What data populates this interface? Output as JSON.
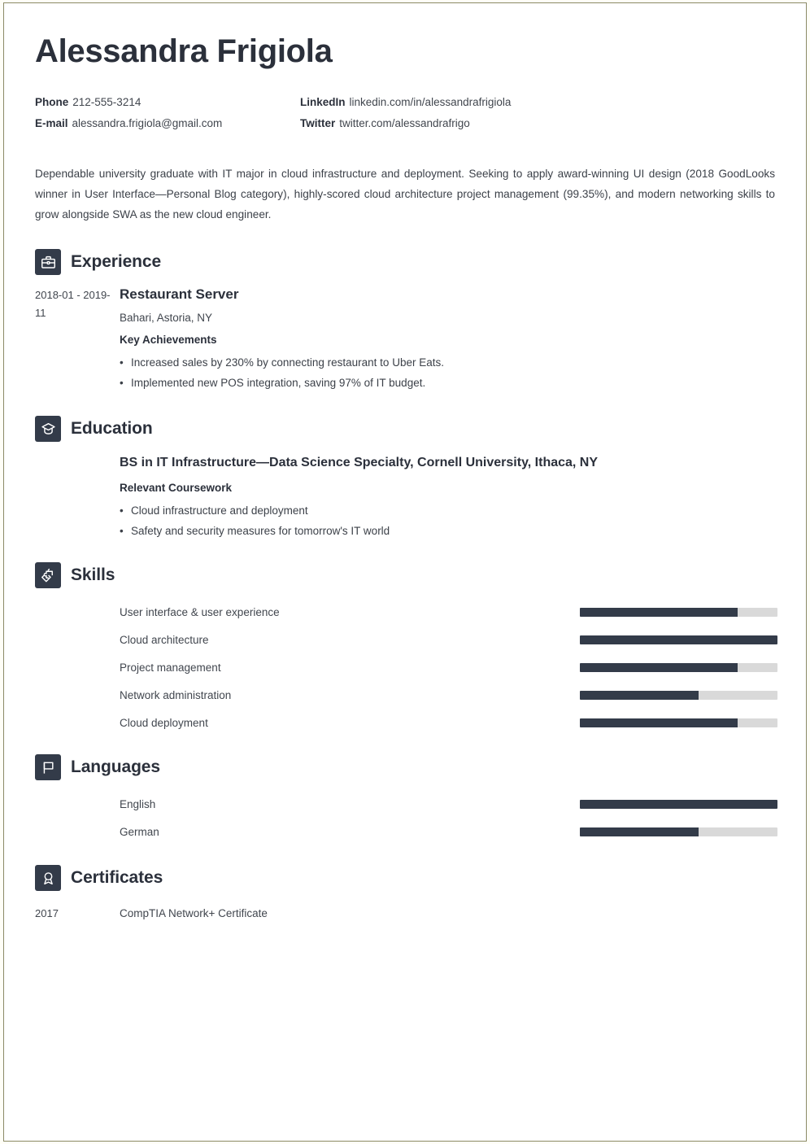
{
  "resume": {
    "name": "Alessandra Frigiola",
    "contact": [
      {
        "label": "Phone",
        "value": "212-555-3214",
        "icon": "phone-icon"
      },
      {
        "label": "LinkedIn",
        "value": "linkedin.com/in/alessandrafrigiola",
        "icon": "linkedin-icon"
      },
      {
        "label": "E-mail",
        "value": "alessandra.frigiola@gmail.com",
        "icon": "email-icon"
      },
      {
        "label": "Twitter",
        "value": "twitter.com/alessandrafrigo",
        "icon": "twitter-icon"
      }
    ],
    "summary": "Dependable university graduate with IT major in cloud infrastructure and deployment. Seeking to apply award-winning UI design (2018 GoodLooks winner in User Interface—Personal Blog category), highly-scored cloud architecture project management (99.35%), and modern networking skills to grow alongside SWA as the new cloud engineer.",
    "sections": {
      "experience": {
        "title": "Experience",
        "icon": "briefcase-icon",
        "entries": [
          {
            "date": "2018-01 - 2019-11",
            "title": "Restaurant Server",
            "company": "Bahari, Astoria, NY",
            "sub_head": "Key Achievements",
            "bullets": [
              "Increased sales by 230% by connecting restaurant to Uber Eats.",
              "Implemented new POS integration, saving 97% of IT budget."
            ]
          }
        ]
      },
      "education": {
        "title": "Education",
        "icon": "graduation-cap-icon",
        "entries": [
          {
            "date": "",
            "title": "BS in IT Infrastructure—Data Science Specialty, Cornell University, Ithaca, NY",
            "sub_head": "Relevant Coursework",
            "bullets": [
              "Cloud infrastructure and deployment",
              "Safety and security measures for tomorrow's IT world"
            ]
          }
        ]
      },
      "skills": {
        "title": "Skills",
        "icon": "puzzle-piece-icon",
        "items": [
          {
            "label": "User interface & user experience",
            "level": 80
          },
          {
            "label": "Cloud architecture",
            "level": 100
          },
          {
            "label": "Project management",
            "level": 80
          },
          {
            "label": "Network administration",
            "level": 60
          },
          {
            "label": "Cloud deployment",
            "level": 80
          }
        ]
      },
      "languages": {
        "title": "Languages",
        "icon": "flag-icon",
        "items": [
          {
            "label": "English",
            "level": 100
          },
          {
            "label": "German",
            "level": 60
          }
        ]
      },
      "certificates": {
        "title": "Certificates",
        "icon": "award-ribbon-icon",
        "items": [
          {
            "date": "2017",
            "name": "CompTIA Network+ Certificate"
          }
        ]
      }
    },
    "colors": {
      "accent_dark": "#333b49",
      "bar_track": "#d9d9d9",
      "text": "#3c4149",
      "page_border": "#8c8a66"
    }
  }
}
